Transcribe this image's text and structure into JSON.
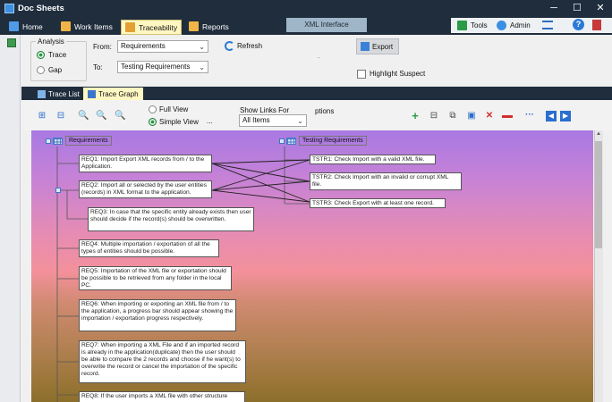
{
  "app": {
    "title": "Doc Sheets"
  },
  "window": {
    "minimize": "─",
    "maximize": "☐",
    "close": "✕"
  },
  "menu": {
    "tabs": [
      {
        "label": "Home",
        "icon": "home-icon"
      },
      {
        "label": "Work Items",
        "icon": "work-items-icon"
      },
      {
        "label": "Traceability",
        "icon": "traceability-icon",
        "active": true
      },
      {
        "label": "Reports",
        "icon": "reports-icon"
      }
    ],
    "context": "XML Interface",
    "tools_label": "Tools",
    "admin_label": "Admin",
    "help_glyph": "?"
  },
  "form": {
    "analysis_label": "Analysis",
    "trace_label": "Trace",
    "gap_label": "Gap",
    "analysis_selected": "Trace",
    "from_label": "From:",
    "from_value": "Requirements",
    "to_label": "To:",
    "to_value": "Testing Requirements",
    "refresh_label": "Refresh",
    "export_label": "Export",
    "highlight_label": "Highlight Suspect",
    "highlight_checked": false,
    "dot": "."
  },
  "subtabs": [
    {
      "label": "Trace List",
      "active": false
    },
    {
      "label": "Trace Graph",
      "active": true
    }
  ],
  "toolbar": {
    "full_view": "Full View",
    "simple_view": "Simple View",
    "view_selected": "Simple View",
    "ellipsis": "...",
    "show_links_label": "Show Links For",
    "show_links_value": "All Items",
    "options_label": "ptions"
  },
  "graph": {
    "left_header": "Requirements",
    "right_header": "Testing Requirements",
    "requirements": [
      {
        "id": "REQ1",
        "text": "REQ1: Import Export XML records from / to the Application."
      },
      {
        "id": "REQ2",
        "text": "REQ2: Import all or selected by the user entities (records) in XML format to the application."
      },
      {
        "id": "REQ3",
        "text": "REQ3: In case that the specific entity already exists then user should decide if the record(s) should be overwritten."
      },
      {
        "id": "REQ4",
        "text": "REQ4: Multiple importation / exportation of all the types of entities should be possible."
      },
      {
        "id": "REQ5",
        "text": "REQ5: Importation of the XML file or exportation should be possible to be retrieved from any folder in the local PC."
      },
      {
        "id": "REQ6",
        "text": "REQ6: When importing or exporting an XML file from / to the application, a progress bar should appear showing the importation / exportation progress respectively."
      },
      {
        "id": "REQ7",
        "text": "REQ7: When importing a XML File and if an imported record is already in the application(duplicate) then the user should be able to compare the 2 records and choose if he want(s) to overwrite the record or cancel the importation of the specific record."
      },
      {
        "id": "REQ8",
        "text": "REQ8: If the user imports a XML file with other structure"
      }
    ],
    "tests": [
      {
        "id": "TSTR1",
        "text": "TSTR1: Check Import with a valid XML file."
      },
      {
        "id": "TSTR2",
        "text": "TSTR2: Check Import with an invalid or corrupt XML file."
      },
      {
        "id": "TSTR3",
        "text": "TSTR3: Check Export with at least one record."
      }
    ],
    "links": [
      [
        "REQ1",
        "TSTR1"
      ],
      [
        "REQ1",
        "TSTR2"
      ],
      [
        "REQ1",
        "TSTR3"
      ],
      [
        "REQ2",
        "TSTR1"
      ],
      [
        "REQ2",
        "TSTR2"
      ],
      [
        "REQ2",
        "TSTR3"
      ]
    ]
  },
  "colors": {
    "titlebar": "#1f2d3d",
    "active_tab": "#fff7c2",
    "accent_green": "#2a9a45"
  }
}
